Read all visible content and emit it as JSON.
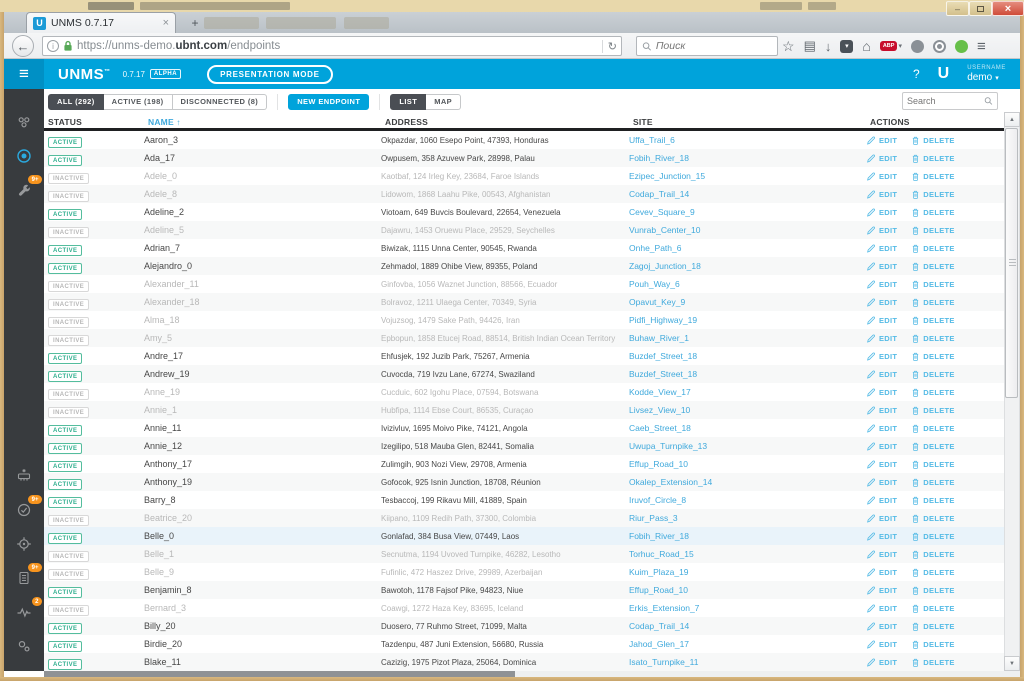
{
  "browser": {
    "tab_title": "UNMS 0.7.17",
    "new_tab": "+",
    "tab_close": "×",
    "favicon_letter": "U",
    "back_glyph": "←",
    "reload_glyph": "↻",
    "info_glyph": "i",
    "url_pre": "https://unms-demo.",
    "url_domain": "ubnt.com",
    "url_path": "/endpoints",
    "search_placeholder": "Поиск",
    "star_glyph": "☆",
    "bookmarks_glyph": "▤",
    "download_glyph": "↓",
    "pocket_glyph": "▾",
    "home_glyph": "⌂",
    "adblock_label": "ABP",
    "adblock_caret": "▾",
    "menu_glyph": "≡",
    "win_min": "–",
    "win_close": "×"
  },
  "app_header": {
    "hamburger": "≡",
    "logo": "UNMS",
    "trademark": "™",
    "version": "0.7.17",
    "alpha_badge": "ALPHA",
    "presentation_mode": "PRESENTATION MODE",
    "help": "?",
    "ubnt_logo": "U",
    "username_label": "USERNAME",
    "username_value": "demo",
    "username_caret": "▾"
  },
  "sidebar": {
    "items": [
      {
        "name": "sites",
        "badge": "",
        "active": false
      },
      {
        "name": "endpoints",
        "badge": "",
        "active": true
      },
      {
        "name": "devices",
        "badge": "9+",
        "active": false
      },
      {
        "name": "firmware",
        "badge": "",
        "active": false
      },
      {
        "name": "discovery",
        "badge": "9+",
        "active": false
      },
      {
        "name": "locate",
        "badge": "",
        "active": false
      },
      {
        "name": "logs",
        "badge": "9+",
        "active": false
      },
      {
        "name": "outages",
        "badge": "2",
        "active": false
      },
      {
        "name": "settings",
        "badge": "",
        "active": false
      }
    ]
  },
  "toolbar": {
    "filters": [
      {
        "label": "ALL (292)",
        "selected": true
      },
      {
        "label": "ACTIVE (198)",
        "selected": false
      },
      {
        "label": "DISCONNECTED (8)",
        "selected": false
      }
    ],
    "new_endpoint": "NEW ENDPOINT",
    "view_toggle": [
      {
        "label": "LIST",
        "selected": true
      },
      {
        "label": "MAP",
        "selected": false
      }
    ],
    "search_placeholder": "Search"
  },
  "table": {
    "columns": [
      "STATUS",
      "NAME",
      "ADDRESS",
      "SITE",
      "ACTIONS"
    ],
    "sort_arrow": "↑",
    "edit_label": "EDIT",
    "delete_label": "DELETE",
    "status_labels": {
      "active": "ACTIVE",
      "inactive": "INACTIVE"
    },
    "rows": [
      {
        "status": "active",
        "name": "Aaron_3",
        "address": "Okpazdar, 1060 Esepo Point, 47393, Honduras",
        "site": "Uffa_Trail_6"
      },
      {
        "status": "active",
        "name": "Ada_17",
        "address": "Owpusem, 358 Azuvew Park, 28998, Palau",
        "site": "Fobih_River_18"
      },
      {
        "status": "inactive",
        "name": "Adele_0",
        "address": "Kaotbaf, 124 Irleg Key, 23684, Faroe Islands",
        "site": "Ezipec_Junction_15"
      },
      {
        "status": "inactive",
        "name": "Adele_8",
        "address": "Lidowom, 1868 Laahu Pike, 00543, Afghanistan",
        "site": "Codap_Trail_14"
      },
      {
        "status": "active",
        "name": "Adeline_2",
        "address": "Viotoam, 649 Buvcis Boulevard, 22654, Venezuela",
        "site": "Cevev_Square_9"
      },
      {
        "status": "inactive",
        "name": "Adeline_5",
        "address": "Dajawru, 1453 Oruewu Place, 29529, Seychelles",
        "site": "Vunrab_Center_10"
      },
      {
        "status": "active",
        "name": "Adrian_7",
        "address": "Biwizak, 1115 Unna Center, 90545, Rwanda",
        "site": "Onhe_Path_6"
      },
      {
        "status": "active",
        "name": "Alejandro_0",
        "address": "Zehmadol, 1889 Ohibe View, 89355, Poland",
        "site": "Zagoj_Junction_18"
      },
      {
        "status": "inactive",
        "name": "Alexander_11",
        "address": "Ginfovba, 1056 Waznet Junction, 88566, Ecuador",
        "site": "Pouh_Way_6"
      },
      {
        "status": "inactive",
        "name": "Alexander_18",
        "address": "Bolravoz, 1211 Ulaega Center, 70349, Syria",
        "site": "Opavut_Key_9"
      },
      {
        "status": "inactive",
        "name": "Alma_18",
        "address": "Vojuzsog, 1479 Sake Path, 94426, Iran",
        "site": "Pidfi_Highway_19"
      },
      {
        "status": "inactive",
        "name": "Amy_5",
        "address": "Epbopun, 1858 Etucej Road, 88514, British Indian Ocean Territory",
        "site": "Buhaw_River_1"
      },
      {
        "status": "active",
        "name": "Andre_17",
        "address": "Ehfusjek, 192 Juzib Park, 75267, Armenia",
        "site": "Buzdef_Street_18"
      },
      {
        "status": "active",
        "name": "Andrew_19",
        "address": "Cuvocda, 719 Ivzu Lane, 67274, Swaziland",
        "site": "Buzdef_Street_18"
      },
      {
        "status": "inactive",
        "name": "Anne_19",
        "address": "Cucduic, 602 Igohu Place, 07594, Botswana",
        "site": "Kodde_View_17"
      },
      {
        "status": "inactive",
        "name": "Annie_1",
        "address": "Hubfipa, 1114 Ebse Court, 86535, Curaçao",
        "site": "Livsez_View_10"
      },
      {
        "status": "active",
        "name": "Annie_11",
        "address": "Ivizivluv, 1695 Moivo Pike, 74121, Angola",
        "site": "Caeb_Street_18"
      },
      {
        "status": "active",
        "name": "Annie_12",
        "address": "Izegilipo, 518 Mauba Glen, 82441, Somalia",
        "site": "Uwupa_Turnpike_13"
      },
      {
        "status": "active",
        "name": "Anthony_17",
        "address": "Zulimgih, 903 Nozi View, 29708, Armenia",
        "site": "Effup_Road_10"
      },
      {
        "status": "active",
        "name": "Anthony_19",
        "address": "Gofocok, 925 Isnin Junction, 18708, Réunion",
        "site": "Okalep_Extension_14"
      },
      {
        "status": "active",
        "name": "Barry_8",
        "address": "Tesbaccoj, 199 Rikavu Mill, 41889, Spain",
        "site": "Iruvof_Circle_8"
      },
      {
        "status": "inactive",
        "name": "Beatrice_20",
        "address": "Kiipano, 1109 Redih Path, 37300, Colombia",
        "site": "Riur_Pass_3"
      },
      {
        "status": "active",
        "name": "Belle_0",
        "address": "Gonlafad, 384 Busa View, 07449, Laos",
        "site": "Fobih_River_18",
        "highlighted": true
      },
      {
        "status": "inactive",
        "name": "Belle_1",
        "address": "Secnutma, 1194 Uvoved Turnpike, 46282, Lesotho",
        "site": "Torhuc_Road_15"
      },
      {
        "status": "inactive",
        "name": "Belle_9",
        "address": "Fufinlic, 472 Haszez Drive, 29989, Azerbaijan",
        "site": "Kuim_Plaza_19"
      },
      {
        "status": "active",
        "name": "Benjamin_8",
        "address": "Bawotoh, 1178 Fajsof Pike, 94823, Niue",
        "site": "Effup_Road_10"
      },
      {
        "status": "inactive",
        "name": "Bernard_3",
        "address": "Coawgi, 1272 Haza Key, 83695, Iceland",
        "site": "Erkis_Extension_7"
      },
      {
        "status": "active",
        "name": "Billy_20",
        "address": "Duosero, 77 Ruhmo Street, 71099, Malta",
        "site": "Codap_Trail_14"
      },
      {
        "status": "active",
        "name": "Birdie_20",
        "address": "Tazdenpu, 487 Juni Extension, 56680, Russia",
        "site": "Jahod_Glen_17"
      },
      {
        "status": "active",
        "name": "Blake_11",
        "address": "Cazizig, 1975 Pizot Plaza, 25064, Dominica",
        "site": "Isato_Turnpike_11"
      }
    ]
  },
  "colors": {
    "accent_blue": "#00A3DB",
    "link_blue": "#3FA9DC",
    "active_badge": "#2FAE8E",
    "badge_orange": "#F7941E",
    "sidebar_bg": "#383B3E",
    "selected_button": "#4A4E54"
  }
}
